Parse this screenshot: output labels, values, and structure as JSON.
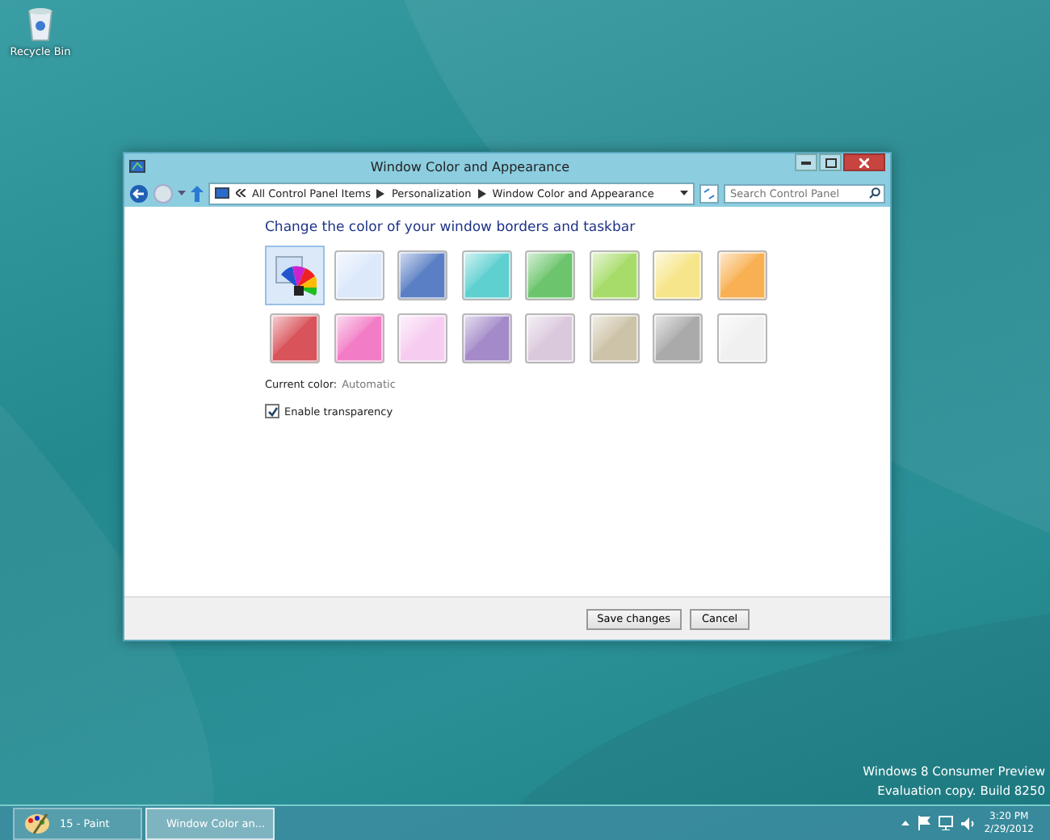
{
  "desktop_icons": [
    {
      "label": "Recycle Bin"
    }
  ],
  "window": {
    "title": "Window Color and Appearance",
    "address": {
      "crumbs": [
        "All Control Panel Items",
        "Personalization",
        "Window Color and Appearance"
      ],
      "search_placeholder": "Search Control Panel"
    },
    "heading": "Change the color of your window borders and taskbar",
    "swatches": [
      {
        "kind": "auto",
        "selected": true,
        "color": "#cfe2f7"
      },
      {
        "kind": "color",
        "selected": false,
        "color": "#dce9fb"
      },
      {
        "kind": "color",
        "selected": false,
        "color": "#5a7fc4"
      },
      {
        "kind": "color",
        "selected": false,
        "color": "#5fd0d0"
      },
      {
        "kind": "color",
        "selected": false,
        "color": "#6cc56c"
      },
      {
        "kind": "color",
        "selected": false,
        "color": "#a8dc6a"
      },
      {
        "kind": "color",
        "selected": false,
        "color": "#f6e58a"
      },
      {
        "kind": "color",
        "selected": false,
        "color": "#f8b052"
      },
      {
        "kind": "color",
        "selected": false,
        "color": "#d9535a"
      },
      {
        "kind": "color",
        "selected": false,
        "color": "#f27dc6"
      },
      {
        "kind": "color",
        "selected": false,
        "color": "#f6cdf0"
      },
      {
        "kind": "color",
        "selected": false,
        "color": "#a48ac8"
      },
      {
        "kind": "color",
        "selected": false,
        "color": "#dac8dc"
      },
      {
        "kind": "color",
        "selected": false,
        "color": "#cdc3a8"
      },
      {
        "kind": "color",
        "selected": false,
        "color": "#aaaaaa"
      },
      {
        "kind": "color",
        "selected": false,
        "color": "#f0f0f0"
      }
    ],
    "current_color": {
      "label": "Current color:",
      "value": "Automatic"
    },
    "transparency": {
      "label": "Enable transparency",
      "checked": true
    },
    "buttons": [
      "Save changes",
      "Cancel"
    ]
  },
  "watermark_lines": [
    "Windows 8 Consumer Preview",
    "Evaluation copy. Build 8250"
  ],
  "taskbar": {
    "items": [
      {
        "label": "15 - Paint",
        "selected": false
      },
      {
        "label": "Window Color an...",
        "selected": true
      }
    ],
    "time": "3:20 PM",
    "date": "2/29/2012"
  }
}
